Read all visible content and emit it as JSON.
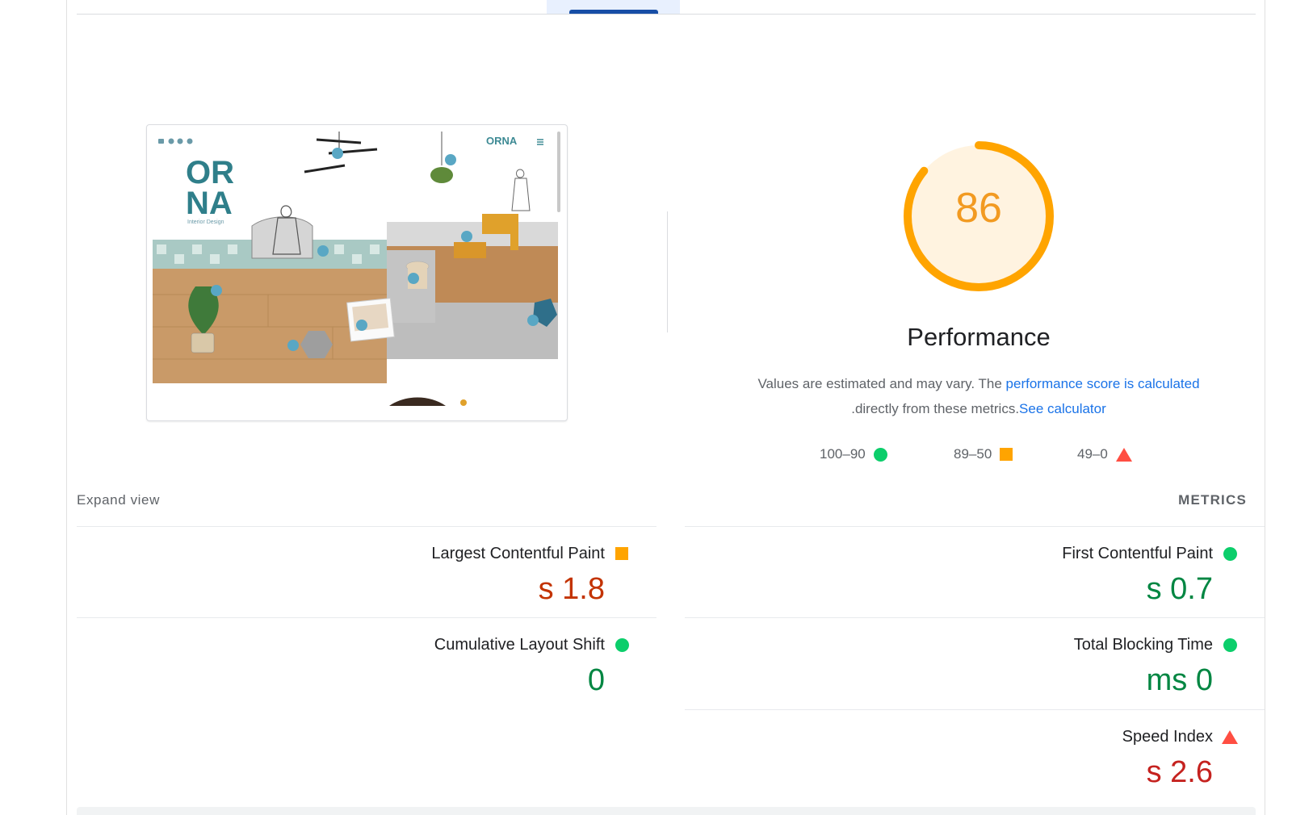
{
  "colors": {
    "pass": "#0cce6b",
    "average": "#ffa400",
    "fail": "#ff4e42",
    "link": "#1a73e8",
    "gauge_stroke": "#ffa400",
    "gauge_fill": "#fff3e0"
  },
  "thumbnail": {
    "brand_small": "ORNA",
    "logo_line1": "OR",
    "logo_line2": "NA",
    "logo_sub": "Interior Design"
  },
  "gauge": {
    "score": "86",
    "score_fraction": 0.86,
    "title": "Performance"
  },
  "description": {
    "text_before": "Values are estimated and may vary. The ",
    "link1": "performance score is calculated",
    "text_middle": ".directly from these metrics.",
    "link2": "See calculator"
  },
  "legend": [
    {
      "label": "100–90",
      "icon": "pass-circle-icon"
    },
    {
      "label": "89–50",
      "icon": "average-square-icon"
    },
    {
      "label": "49–0",
      "icon": "fail-triangle-icon"
    }
  ],
  "headers": {
    "expand": "Expand view",
    "metrics": "METRICS"
  },
  "metrics": [
    {
      "name": "Largest Contentful Paint",
      "value": "s 1.8",
      "rating": "average"
    },
    {
      "name": "First Contentful Paint",
      "value": "s 0.7",
      "rating": "pass"
    },
    {
      "name": "Cumulative Layout Shift",
      "value": "0",
      "rating": "pass"
    },
    {
      "name": "Total Blocking Time",
      "value": "ms 0",
      "rating": "pass"
    },
    {
      "name": "Speed Index",
      "value": "s 2.6",
      "rating": "fail"
    }
  ]
}
